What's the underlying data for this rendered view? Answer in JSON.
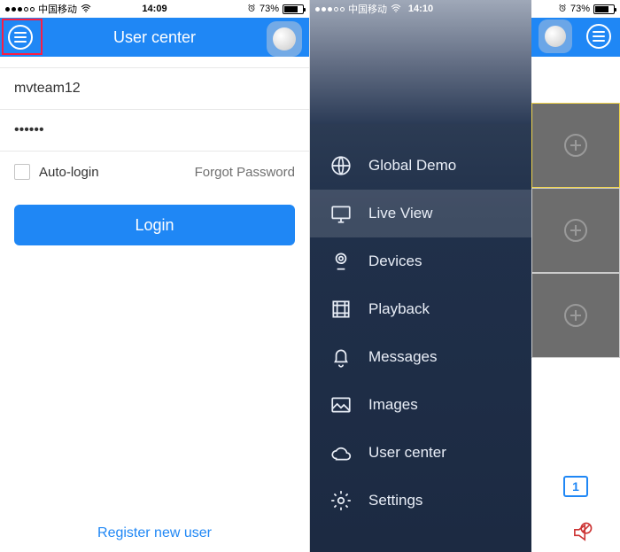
{
  "statusA": {
    "carrier": "中国移动",
    "time": "14:09",
    "battery": "73%"
  },
  "statusB": {
    "carrier": "中国移动",
    "time": "14:10",
    "battery": "73%"
  },
  "header": {
    "title": "User center"
  },
  "login": {
    "username": "mvteam12",
    "password": "••••••",
    "auto_login_label": "Auto-login",
    "forgot_label": "Forgot Password",
    "login_label": "Login",
    "register_label": "Register new user"
  },
  "drawer": {
    "items": [
      {
        "label": "Global Demo"
      },
      {
        "label": "Live View"
      },
      {
        "label": "Devices"
      },
      {
        "label": "Playback"
      },
      {
        "label": "Messages"
      },
      {
        "label": "Images"
      },
      {
        "label": "User center"
      },
      {
        "label": "Settings"
      }
    ]
  },
  "grid": {
    "layout_label": "1"
  }
}
